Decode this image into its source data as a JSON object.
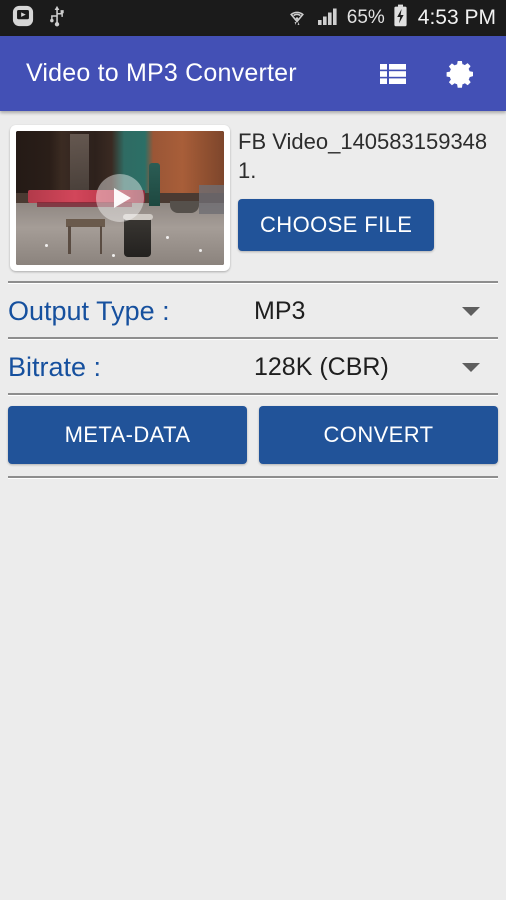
{
  "status_bar": {
    "left_icons": [
      "screen-recorder-icon",
      "usb-icon"
    ],
    "wifi_icon": "wifi-icon",
    "signal_icon": "cellular-signal-icon",
    "battery_percent": "65%",
    "battery_icon": "battery-charging-icon",
    "clock": "4:53 PM",
    "background_color": "#1b1b1b"
  },
  "app_bar": {
    "title": "Video to MP3 Converter",
    "list_icon": "list-view-icon",
    "settings_icon": "gear-icon",
    "background_color": "#4350b5"
  },
  "file_section": {
    "thumbnail_name": "video-thumbnail",
    "play_icon": "play-icon",
    "file_name": "FB Video_1405831593481.",
    "choose_file_label": "CHOOSE FILE"
  },
  "settings": [
    {
      "label": "Output Type :",
      "value": "MP3",
      "name": "output-type",
      "caret_icon": "chevron-down-icon"
    },
    {
      "label": "Bitrate :",
      "value": "128K (CBR)",
      "name": "bitrate",
      "caret_icon": "chevron-down-icon"
    }
  ],
  "actions": {
    "meta_data_label": "META-DATA",
    "convert_label": "CONVERT"
  },
  "colors": {
    "accent_blue": "#215399",
    "app_bar_blue": "#4350b5",
    "label_blue": "#16509e",
    "page_background": "#ececec",
    "divider_gray": "#8e8e8e"
  }
}
